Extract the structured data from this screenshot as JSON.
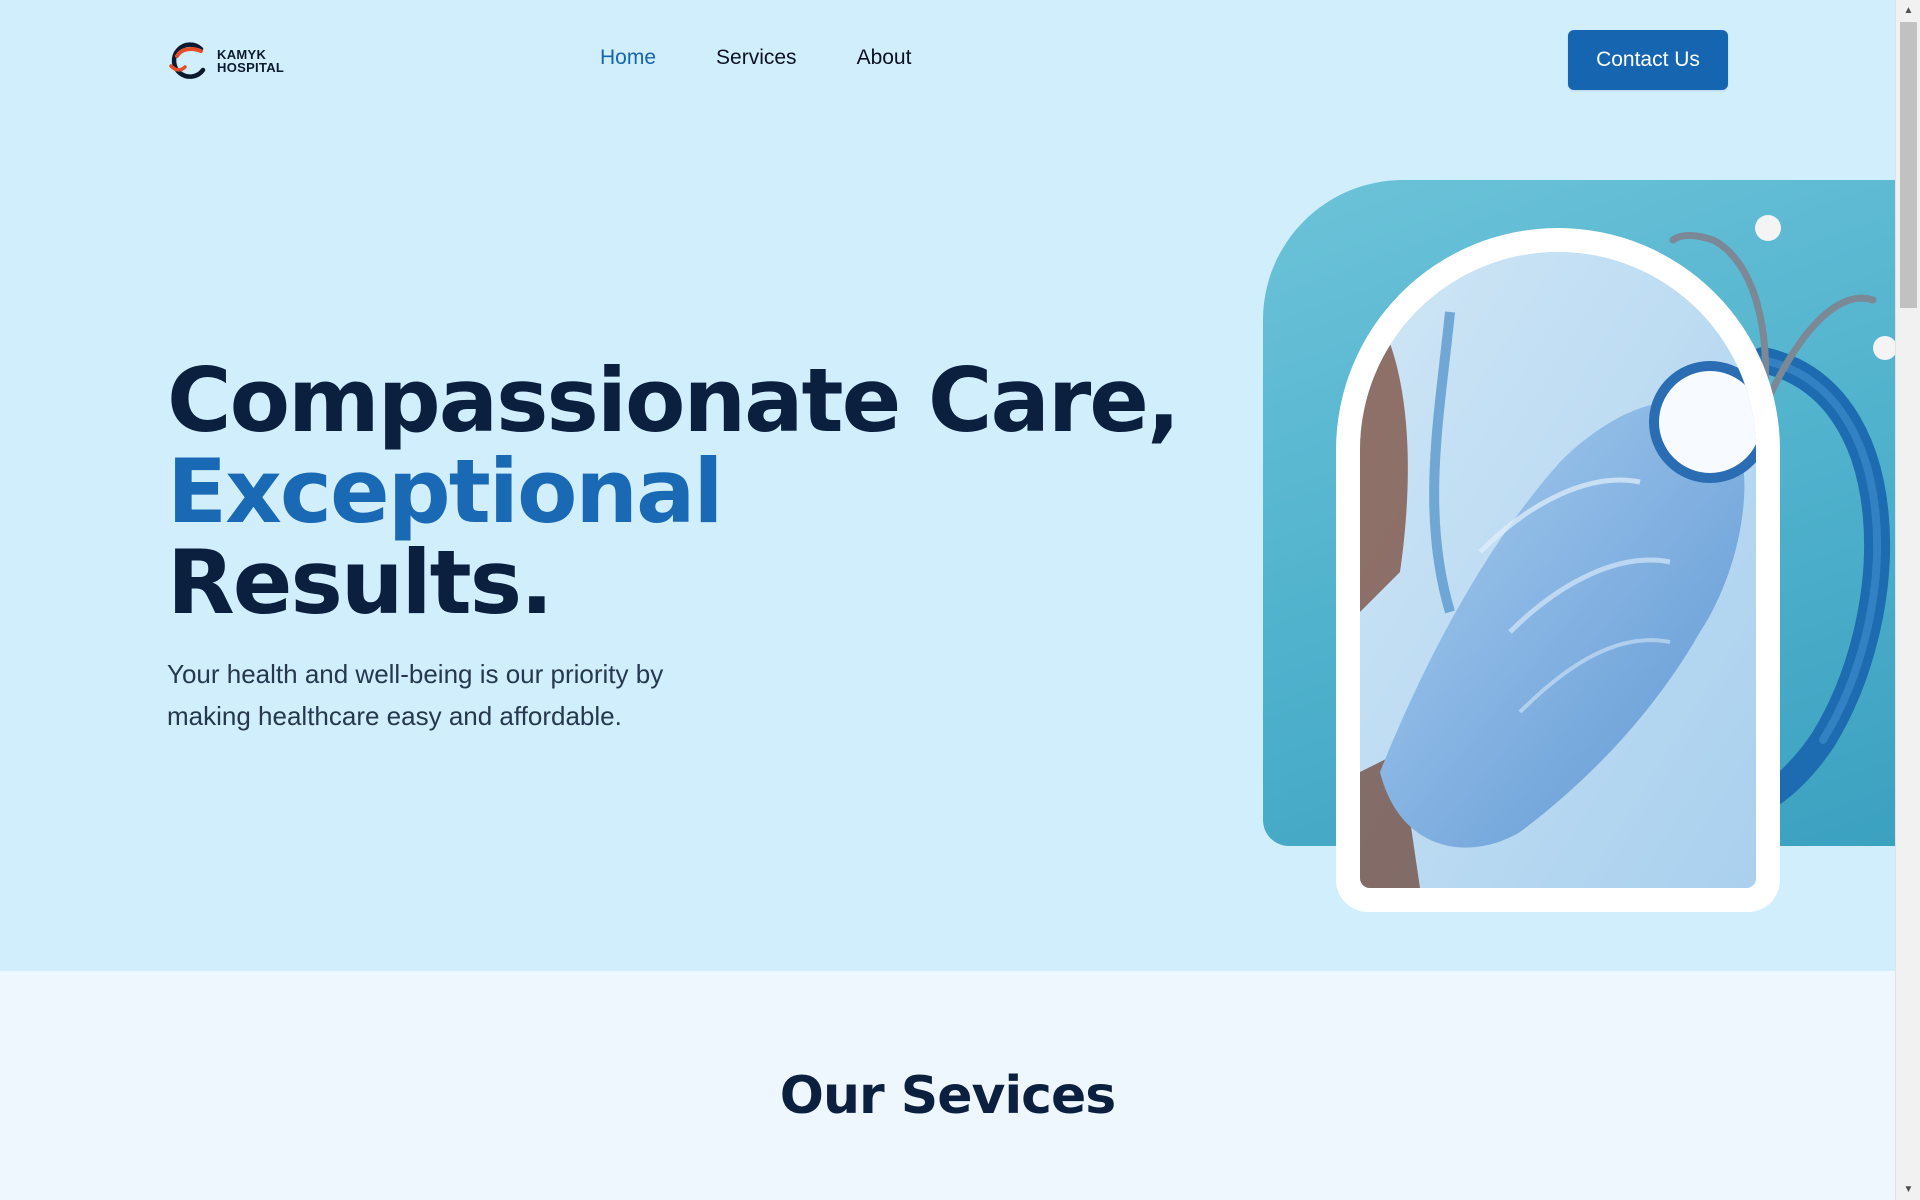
{
  "brand": {
    "name_line1": "KAMYK",
    "name_line2": "HOSPITAL",
    "mark_colors": [
      "#0b1a30",
      "#e2502b"
    ]
  },
  "nav": {
    "items": [
      {
        "label": "Home",
        "active": true
      },
      {
        "label": "Services",
        "active": false
      },
      {
        "label": "About",
        "active": false
      }
    ],
    "cta_label": "Contact Us"
  },
  "hero": {
    "headline_line1": "Compassionate Care,",
    "headline_accent": "Exceptional",
    "headline_line3": "Results.",
    "subtext": "Your health and well-being is our priority by making healthcare easy and affordable.",
    "image_icon": "doctor-stethoscope-photo"
  },
  "services": {
    "title": "Our Sevices"
  },
  "colors": {
    "primary": "#1565b0",
    "accent_text": "#1a69b4",
    "heading": "#0b1f3f",
    "hero_bg": "#d1eefc",
    "section_bg": "#eef7fd",
    "teal": "#4fb1cc",
    "logo_accent": "#e2502b"
  }
}
